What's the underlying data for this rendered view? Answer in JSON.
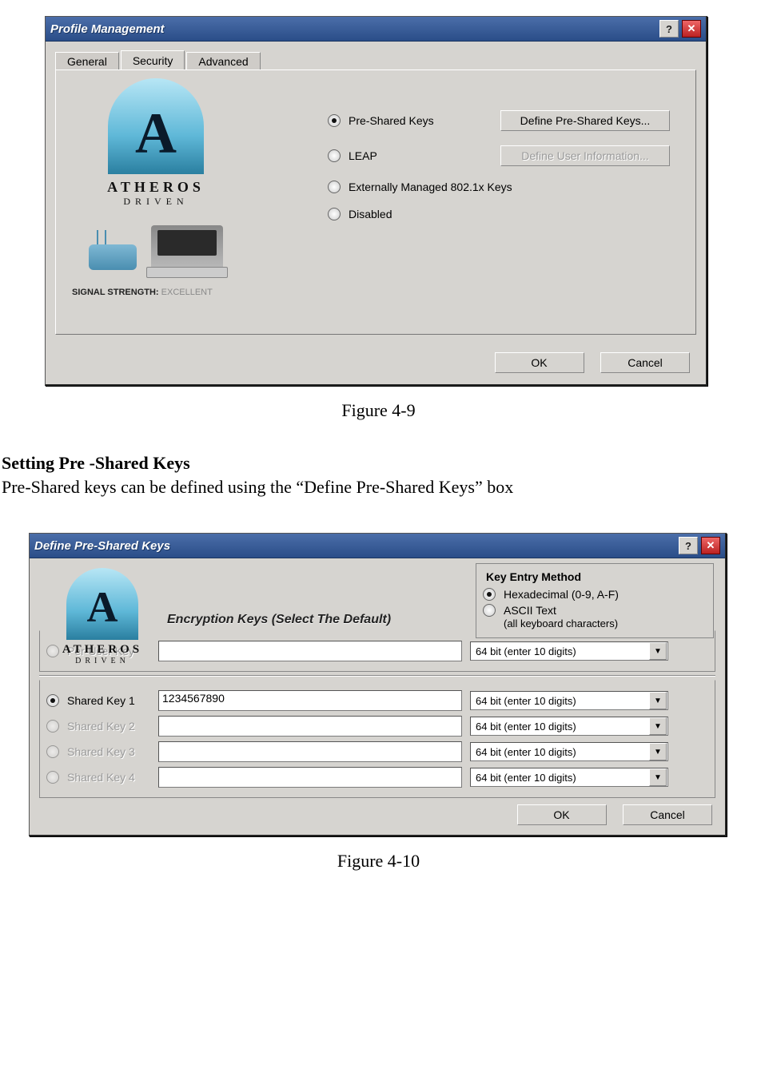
{
  "dialog1": {
    "title": "Profile Management",
    "tabs": [
      "General",
      "Security",
      "Advanced"
    ],
    "active_tab": "Security",
    "logo_brand": "ATHEROS",
    "logo_sub": "DRIVEN",
    "signal_label": "SIGNAL STRENGTH:",
    "signal_value": "EXCELLENT",
    "options": {
      "psk": "Pre-Shared Keys",
      "leap": "LEAP",
      "ext": "Externally Managed 802.1x Keys",
      "disabled": "Disabled"
    },
    "buttons": {
      "define_psk": "Define Pre-Shared Keys...",
      "define_user": "Define User Information..."
    },
    "ok": "OK",
    "cancel": "Cancel"
  },
  "figure1_caption": "Figure 4-9",
  "section_heading": "Setting Pre -Shared Keys",
  "section_body": "Pre-Shared keys can be defined using the “Define Pre-Shared Keys” box",
  "dialog2": {
    "title": "Define Pre-Shared Keys",
    "logo_brand": "ATHEROS",
    "logo_sub": "DRIVEN",
    "key_entry_title": "Key Entry Method",
    "key_entry_opts": {
      "hex": "Hexadecimal (0-9, A-F)",
      "ascii_l1": "ASCII Text",
      "ascii_l2": "(all keyboard characters)"
    },
    "enc_title": "Encryption Keys (Select The Default)",
    "rows": {
      "peruser": "Per-User Key",
      "sk1": "Shared Key 1",
      "sk2": "Shared Key 2",
      "sk3": "Shared Key 3",
      "sk4": "Shared Key 4"
    },
    "sk1_value": "1234567890",
    "combo_text": "64 bit (enter 10 digits)",
    "ok": "OK",
    "cancel": "Cancel"
  },
  "figure2_caption": "Figure 4-10"
}
